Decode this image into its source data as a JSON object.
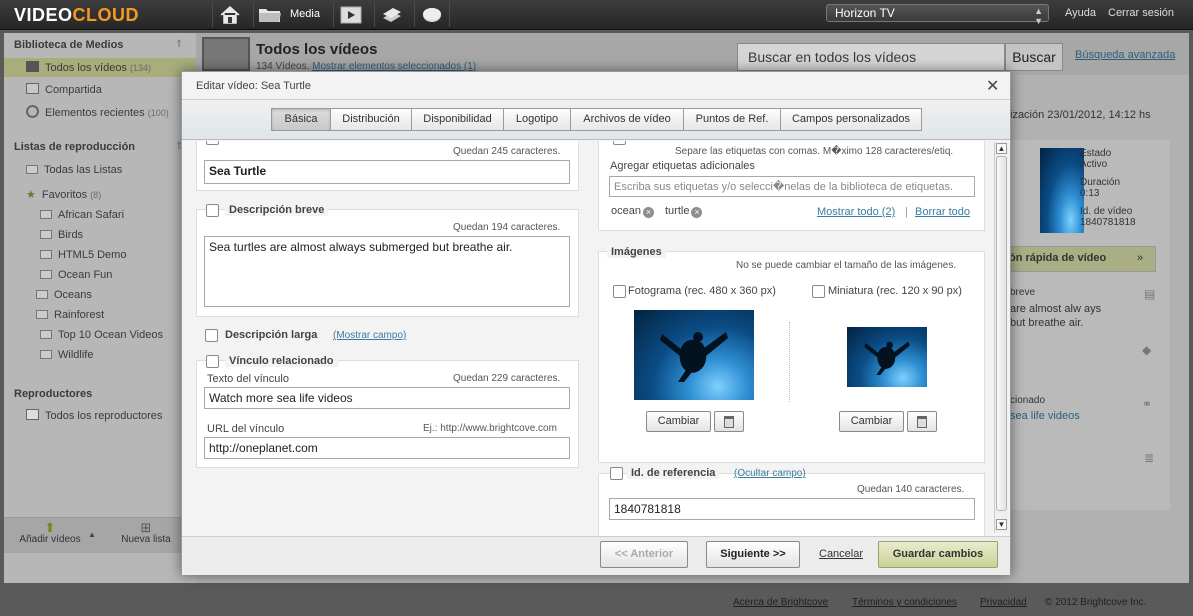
{
  "app": {
    "logo_video": "VIDEO",
    "logo_cloud": "CLOUD",
    "media_label": "Media",
    "account": "Horizon TV",
    "help": "Ayuda",
    "logout": "Cerrar sesión"
  },
  "sidebar": {
    "library_title": "Biblioteca de Medios",
    "library_items": [
      {
        "label": "Todos los vídeos",
        "count": "(134)"
      },
      {
        "label": "Compartida",
        "count": ""
      },
      {
        "label": "Elementos recientes",
        "count": "(100)"
      }
    ],
    "playlists_title": "Listas de reproducción",
    "playlist_root": "Todas las Listas",
    "favorites": {
      "label": "Favoritos",
      "count": "(8)"
    },
    "playlists": [
      "African Safari",
      "Birds",
      "HTML5 Demo",
      "Ocean Fun",
      "Oceans",
      "Rainforest",
      "Top 10 Ocean Videos",
      "Wildlife"
    ],
    "players_title": "Reproductores",
    "players_item": "Todos los reproductores",
    "add_videos": "Añadir vídeos",
    "new_list": "Nueva lista"
  },
  "main": {
    "title": "Todos los vídeos",
    "subtitle_count": "134 Vídeos.",
    "subtitle_link": "Mostrar elementos seleccionados (1)",
    "search_placeholder": "Buscar en todos los vídeos",
    "search_button": "Buscar",
    "advanced_search": "Búsqueda avanzada",
    "updated_text": "ización 23/01/2012, 14:12 hs",
    "right_panel": {
      "estado_label": "Estado",
      "estado_value": "Activo",
      "duracion_label": "Duración",
      "duracion_value": "0:13",
      "id_label": "Id. de vídeo",
      "id_value": "1840781818",
      "quick_edit": "ón rápida de vídeo",
      "short_label": "breve",
      "short_text_1": "are almost alw ays",
      "short_text_2": "but breathe air.",
      "link_label": "cionado",
      "link_text": "sea life videos"
    }
  },
  "footer": {
    "about": "Acerca de Brightcove",
    "terms": "Términos y condiciones",
    "privacy": "Privacidad",
    "copyright": "© 2012 Brightcove Inc."
  },
  "modal": {
    "title": "Editar vídeo: Sea Turtle",
    "tabs": [
      "Básica",
      "Distribución",
      "Disponibilidad",
      "Logotipo",
      "Archivos de vídeo",
      "Puntos de Ref.",
      "Campos personalizados"
    ],
    "name": {
      "remaining": "Quedan 245 caracteres.",
      "value": "Sea Turtle"
    },
    "short_desc": {
      "label": "Descripción breve",
      "remaining": "Quedan 194 caracteres.",
      "value": "Sea turtles are almost always submerged but breathe air."
    },
    "long_desc": {
      "label": "Descripción larga",
      "link": "(Mostrar campo)"
    },
    "related_link": {
      "label": "Vínculo relacionado",
      "text_label": "Texto del vínculo",
      "text_remaining": "Quedan 229 caracteres.",
      "text_value": "Watch more sea life videos",
      "url_label": "URL del vínculo",
      "url_example": "Ej.: http://www.brightcove.com",
      "url_value": "http://oneplanet.com"
    },
    "tags": {
      "hint": "Separe las etiquetas con comas. M�ximo 128 caracteres/etiq.",
      "add_label": "Agregar etiquetas adicionales",
      "placeholder": "Escriba sus etiquetas y/o selecci�nelas de la biblioteca de etiquetas.",
      "items": [
        "ocean",
        "turtle"
      ],
      "show_all": "Mostrar todo (2)",
      "delete_all": "Borrar todo"
    },
    "images": {
      "title": "Imágenes",
      "note": "No se puede cambiar el tamaño de las imágenes.",
      "frame_label": "Fotograma (rec. 480 x 360 px)",
      "thumb_label": "Miniatura (rec. 120 x 90 px)",
      "change": "Cambiar"
    },
    "reference": {
      "label": "Id. de referencia",
      "link": "(Ocultar campo)",
      "remaining": "Quedan 140 caracteres.",
      "value": "1840781818"
    },
    "footer": {
      "prev": "<< Anterior",
      "next": "Siguiente >>",
      "cancel": "Cancelar",
      "save": "Guardar cambios"
    }
  }
}
